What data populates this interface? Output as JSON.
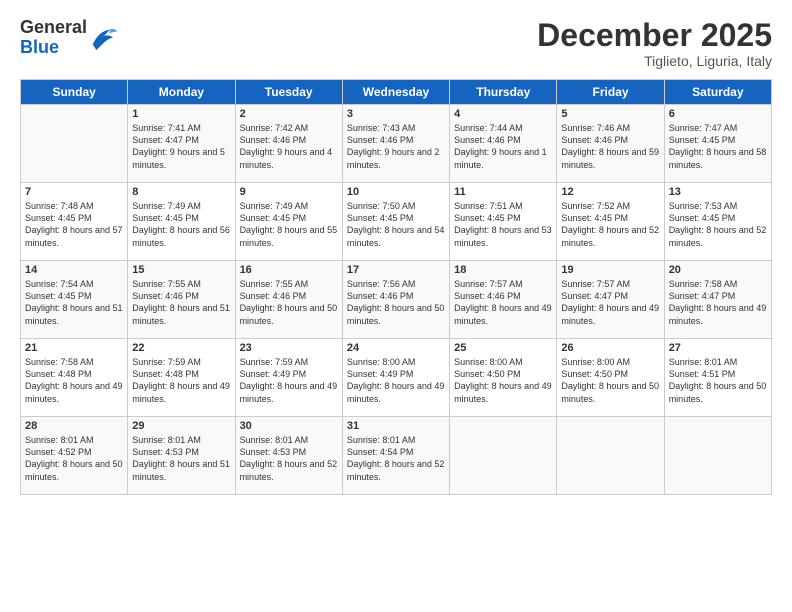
{
  "logo": {
    "general": "General",
    "blue": "Blue"
  },
  "header": {
    "month": "December 2025",
    "location": "Tiglieto, Liguria, Italy"
  },
  "days_of_week": [
    "Sunday",
    "Monday",
    "Tuesday",
    "Wednesday",
    "Thursday",
    "Friday",
    "Saturday"
  ],
  "weeks": [
    [
      {
        "day": "",
        "sunrise": "",
        "sunset": "",
        "daylight": ""
      },
      {
        "day": "1",
        "sunrise": "Sunrise: 7:41 AM",
        "sunset": "Sunset: 4:47 PM",
        "daylight": "Daylight: 9 hours and 5 minutes."
      },
      {
        "day": "2",
        "sunrise": "Sunrise: 7:42 AM",
        "sunset": "Sunset: 4:46 PM",
        "daylight": "Daylight: 9 hours and 4 minutes."
      },
      {
        "day": "3",
        "sunrise": "Sunrise: 7:43 AM",
        "sunset": "Sunset: 4:46 PM",
        "daylight": "Daylight: 9 hours and 2 minutes."
      },
      {
        "day": "4",
        "sunrise": "Sunrise: 7:44 AM",
        "sunset": "Sunset: 4:46 PM",
        "daylight": "Daylight: 9 hours and 1 minute."
      },
      {
        "day": "5",
        "sunrise": "Sunrise: 7:46 AM",
        "sunset": "Sunset: 4:46 PM",
        "daylight": "Daylight: 8 hours and 59 minutes."
      },
      {
        "day": "6",
        "sunrise": "Sunrise: 7:47 AM",
        "sunset": "Sunset: 4:45 PM",
        "daylight": "Daylight: 8 hours and 58 minutes."
      }
    ],
    [
      {
        "day": "7",
        "sunrise": "Sunrise: 7:48 AM",
        "sunset": "Sunset: 4:45 PM",
        "daylight": "Daylight: 8 hours and 57 minutes."
      },
      {
        "day": "8",
        "sunrise": "Sunrise: 7:49 AM",
        "sunset": "Sunset: 4:45 PM",
        "daylight": "Daylight: 8 hours and 56 minutes."
      },
      {
        "day": "9",
        "sunrise": "Sunrise: 7:49 AM",
        "sunset": "Sunset: 4:45 PM",
        "daylight": "Daylight: 8 hours and 55 minutes."
      },
      {
        "day": "10",
        "sunrise": "Sunrise: 7:50 AM",
        "sunset": "Sunset: 4:45 PM",
        "daylight": "Daylight: 8 hours and 54 minutes."
      },
      {
        "day": "11",
        "sunrise": "Sunrise: 7:51 AM",
        "sunset": "Sunset: 4:45 PM",
        "daylight": "Daylight: 8 hours and 53 minutes."
      },
      {
        "day": "12",
        "sunrise": "Sunrise: 7:52 AM",
        "sunset": "Sunset: 4:45 PM",
        "daylight": "Daylight: 8 hours and 52 minutes."
      },
      {
        "day": "13",
        "sunrise": "Sunrise: 7:53 AM",
        "sunset": "Sunset: 4:45 PM",
        "daylight": "Daylight: 8 hours and 52 minutes."
      }
    ],
    [
      {
        "day": "14",
        "sunrise": "Sunrise: 7:54 AM",
        "sunset": "Sunset: 4:45 PM",
        "daylight": "Daylight: 8 hours and 51 minutes."
      },
      {
        "day": "15",
        "sunrise": "Sunrise: 7:55 AM",
        "sunset": "Sunset: 4:46 PM",
        "daylight": "Daylight: 8 hours and 51 minutes."
      },
      {
        "day": "16",
        "sunrise": "Sunrise: 7:55 AM",
        "sunset": "Sunset: 4:46 PM",
        "daylight": "Daylight: 8 hours and 50 minutes."
      },
      {
        "day": "17",
        "sunrise": "Sunrise: 7:56 AM",
        "sunset": "Sunset: 4:46 PM",
        "daylight": "Daylight: 8 hours and 50 minutes."
      },
      {
        "day": "18",
        "sunrise": "Sunrise: 7:57 AM",
        "sunset": "Sunset: 4:46 PM",
        "daylight": "Daylight: 8 hours and 49 minutes."
      },
      {
        "day": "19",
        "sunrise": "Sunrise: 7:57 AM",
        "sunset": "Sunset: 4:47 PM",
        "daylight": "Daylight: 8 hours and 49 minutes."
      },
      {
        "day": "20",
        "sunrise": "Sunrise: 7:58 AM",
        "sunset": "Sunset: 4:47 PM",
        "daylight": "Daylight: 8 hours and 49 minutes."
      }
    ],
    [
      {
        "day": "21",
        "sunrise": "Sunrise: 7:58 AM",
        "sunset": "Sunset: 4:48 PM",
        "daylight": "Daylight: 8 hours and 49 minutes."
      },
      {
        "day": "22",
        "sunrise": "Sunrise: 7:59 AM",
        "sunset": "Sunset: 4:48 PM",
        "daylight": "Daylight: 8 hours and 49 minutes."
      },
      {
        "day": "23",
        "sunrise": "Sunrise: 7:59 AM",
        "sunset": "Sunset: 4:49 PM",
        "daylight": "Daylight: 8 hours and 49 minutes."
      },
      {
        "day": "24",
        "sunrise": "Sunrise: 8:00 AM",
        "sunset": "Sunset: 4:49 PM",
        "daylight": "Daylight: 8 hours and 49 minutes."
      },
      {
        "day": "25",
        "sunrise": "Sunrise: 8:00 AM",
        "sunset": "Sunset: 4:50 PM",
        "daylight": "Daylight: 8 hours and 49 minutes."
      },
      {
        "day": "26",
        "sunrise": "Sunrise: 8:00 AM",
        "sunset": "Sunset: 4:50 PM",
        "daylight": "Daylight: 8 hours and 50 minutes."
      },
      {
        "day": "27",
        "sunrise": "Sunrise: 8:01 AM",
        "sunset": "Sunset: 4:51 PM",
        "daylight": "Daylight: 8 hours and 50 minutes."
      }
    ],
    [
      {
        "day": "28",
        "sunrise": "Sunrise: 8:01 AM",
        "sunset": "Sunset: 4:52 PM",
        "daylight": "Daylight: 8 hours and 50 minutes."
      },
      {
        "day": "29",
        "sunrise": "Sunrise: 8:01 AM",
        "sunset": "Sunset: 4:53 PM",
        "daylight": "Daylight: 8 hours and 51 minutes."
      },
      {
        "day": "30",
        "sunrise": "Sunrise: 8:01 AM",
        "sunset": "Sunset: 4:53 PM",
        "daylight": "Daylight: 8 hours and 52 minutes."
      },
      {
        "day": "31",
        "sunrise": "Sunrise: 8:01 AM",
        "sunset": "Sunset: 4:54 PM",
        "daylight": "Daylight: 8 hours and 52 minutes."
      },
      {
        "day": "",
        "sunrise": "",
        "sunset": "",
        "daylight": ""
      },
      {
        "day": "",
        "sunrise": "",
        "sunset": "",
        "daylight": ""
      },
      {
        "day": "",
        "sunrise": "",
        "sunset": "",
        "daylight": ""
      }
    ]
  ]
}
